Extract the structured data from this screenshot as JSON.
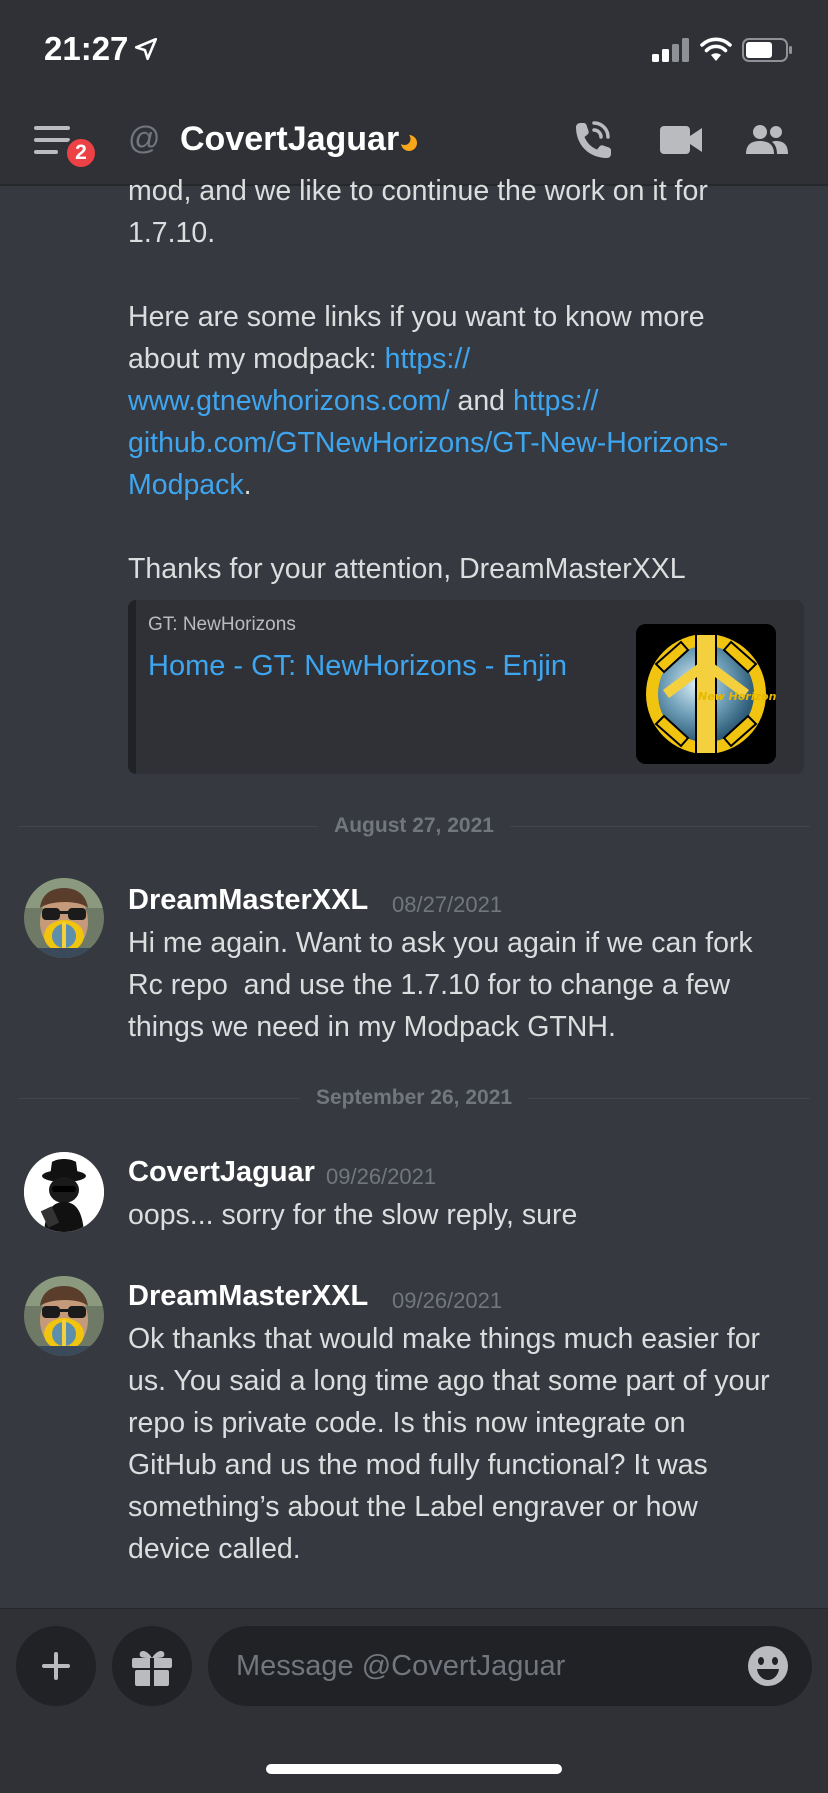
{
  "status_bar": {
    "time": "21:27"
  },
  "header": {
    "badge_count": "2",
    "channel_name": "CovertJaguar",
    "icons": [
      "menu-icon",
      "at-icon",
      "moon-icon",
      "phone-call-icon",
      "video-icon",
      "members-icon"
    ]
  },
  "messages": {
    "continued": {
      "line1": "mod, and we like to continue the work on it for",
      "line2": "1.7.10.",
      "links_l1": "Here are some links if you want to know more",
      "links_l2_text": "about my modpack: ",
      "link1_part1": "https://",
      "link1_part2": "www.gtnewhorizons.com/",
      "and_text": " and ",
      "link2_part1": "https://",
      "link2_part2": "github.com/GTNewHorizons/GT-New-Horizons-",
      "link2_part3": "Modpack",
      "period": ".",
      "thanks": "Thanks for your attention, DreamMasterXXL"
    },
    "embed": {
      "provider": "GT: NewHorizons",
      "title": "Home - GT: NewHorizons - Enjin",
      "thumb_text": "New Horizons"
    },
    "divider1": "August 27, 2021",
    "msg1": {
      "author": "DreamMasterXXL",
      "timestamp": "08/27/2021",
      "lines": [
        "Hi me again. Want to ask you again if we can fork",
        "Rc repo  and use the 1.7.10 for to change a few",
        "things we need in my Modpack GTNH."
      ]
    },
    "divider2": "September 26, 2021",
    "msg2": {
      "author": "CovertJaguar",
      "timestamp": "09/26/2021",
      "lines": [
        "oops... sorry for the slow reply, sure"
      ]
    },
    "msg3": {
      "author": "DreamMasterXXL",
      "timestamp": "09/26/2021",
      "lines": [
        "Ok thanks that would make things much easier for",
        "us. You said a long time ago that some part of your",
        "repo is private code. Is this now integrate on",
        "GitHub and us the mod fully functional? It was",
        "something’s about the Label engraver or how",
        "device called."
      ]
    }
  },
  "composer": {
    "placeholder": "Message @CovertJaguar",
    "icons": [
      "plus-icon",
      "gift-icon",
      "emoji-icon"
    ]
  },
  "colors": {
    "background": "#36393f",
    "header": "#2f3136",
    "link": "#3ea6f0",
    "badge": "#ed4245"
  }
}
